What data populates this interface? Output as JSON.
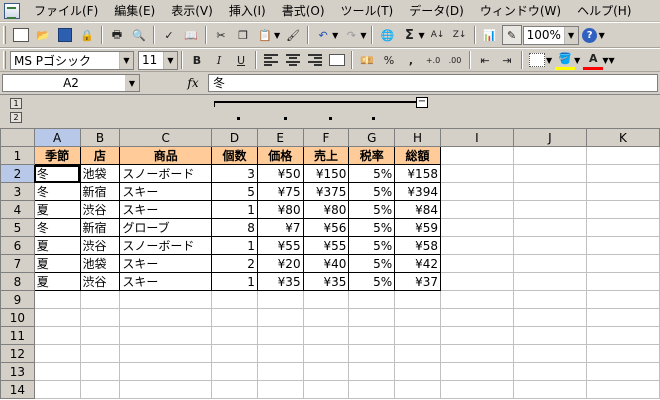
{
  "menu": [
    "ファイル(F)",
    "編集(E)",
    "表示(V)",
    "挿入(I)",
    "書式(O)",
    "ツール(T)",
    "データ(D)",
    "ウィンドウ(W)",
    "ヘルプ(H)"
  ],
  "toolbar": {
    "zoom": "100%",
    "sum_symbol": "Σ",
    "font_name": "MS Pゴシック",
    "font_size": "11",
    "bold": "B",
    "italic": "I",
    "underline": "U",
    "percent": "%",
    "comma": ",",
    "inc_decimal": "+.0",
    "dec_decimal": ".00",
    "help": "?",
    "font_color": "A"
  },
  "formula_bar": {
    "name_box": "A2",
    "fx": "fx",
    "value": "冬"
  },
  "outline": {
    "level1": "1",
    "level2": "2",
    "collapse": "−"
  },
  "sheet": {
    "columns": [
      "A",
      "B",
      "C",
      "D",
      "E",
      "F",
      "G",
      "H",
      "I",
      "J",
      "K"
    ],
    "header": [
      "季節",
      "店",
      "商品",
      "個数",
      "価格",
      "売上",
      "税率",
      "総額"
    ],
    "rows": [
      [
        "冬",
        "池袋",
        "スノーボード",
        "3",
        "¥50",
        "¥150",
        "5%",
        "¥158"
      ],
      [
        "冬",
        "新宿",
        "スキー",
        "5",
        "¥75",
        "¥375",
        "5%",
        "¥394"
      ],
      [
        "夏",
        "渋谷",
        "スキー",
        "1",
        "¥80",
        "¥80",
        "5%",
        "¥84"
      ],
      [
        "冬",
        "新宿",
        "グローブ",
        "8",
        "¥7",
        "¥56",
        "5%",
        "¥59"
      ],
      [
        "夏",
        "渋谷",
        "スノーボード",
        "1",
        "¥55",
        "¥55",
        "5%",
        "¥58"
      ],
      [
        "夏",
        "池袋",
        "スキー",
        "2",
        "¥20",
        "¥40",
        "5%",
        "¥42"
      ],
      [
        "夏",
        "渋谷",
        "スキー",
        "1",
        "¥35",
        "¥35",
        "5%",
        "¥37"
      ]
    ],
    "row_numbers": [
      "1",
      "2",
      "3",
      "4",
      "5",
      "6",
      "7",
      "8",
      "9",
      "10",
      "11",
      "12",
      "13",
      "14"
    ]
  },
  "colors": {
    "header_fill": "#ffcc99",
    "selected_header": "#b8c8e8",
    "chrome": "#d4d0c8"
  }
}
